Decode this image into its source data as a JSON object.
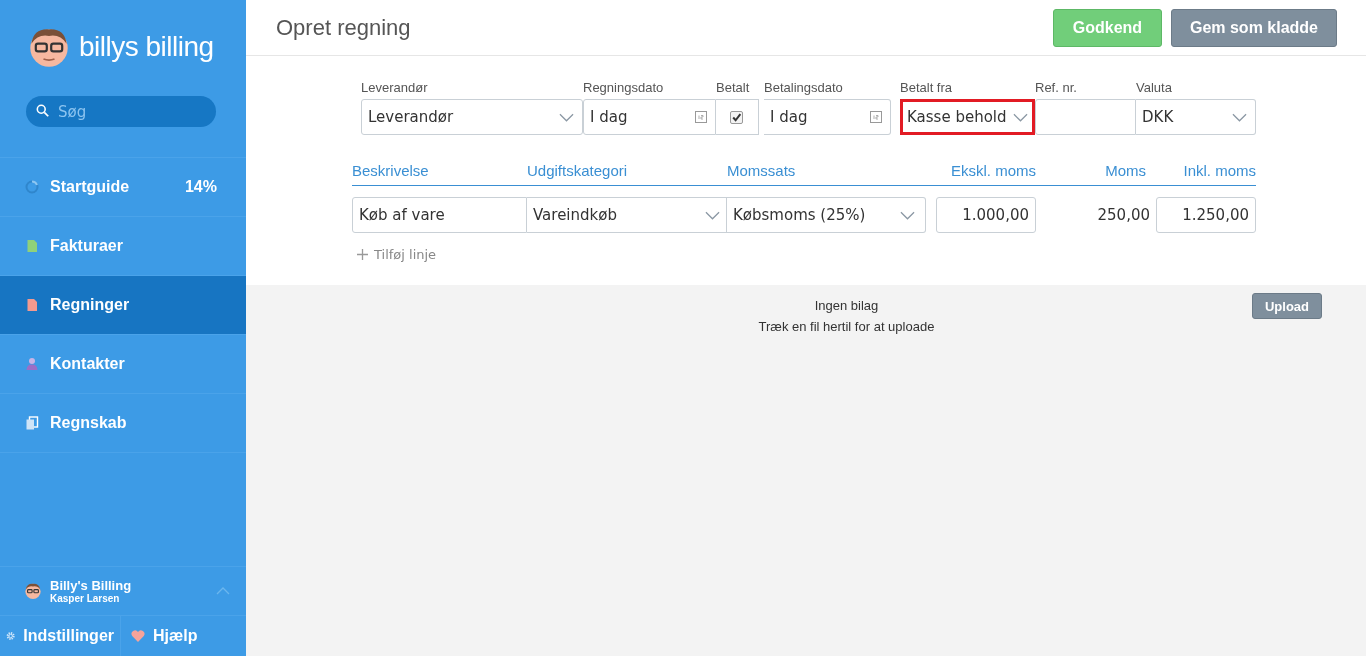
{
  "sidebar": {
    "brand": "billys billing",
    "search": {
      "placeholder": "Søg"
    },
    "items": [
      {
        "kind": "guide",
        "label": "Startguide",
        "badge": "14%",
        "selected": false
      },
      {
        "kind": "invoice",
        "label": "Fakturaer",
        "selected": false
      },
      {
        "kind": "bill",
        "label": "Regninger",
        "selected": true
      },
      {
        "kind": "contact",
        "label": "Kontakter",
        "selected": false
      },
      {
        "kind": "accounting",
        "label": "Regnskab",
        "selected": false
      }
    ],
    "account": {
      "company": "Billy's Billing",
      "user": "Kasper Larsen"
    },
    "footer": [
      {
        "kind": "settings",
        "label": "Indstillinger"
      },
      {
        "kind": "help",
        "label": "Hjælp"
      }
    ]
  },
  "header": {
    "title": "Opret regning",
    "buttons": [
      {
        "kind": "primary",
        "label": "Godkend"
      },
      {
        "kind": "secondary",
        "label": "Gem som kladde"
      }
    ]
  },
  "form": {
    "fields": [
      {
        "kind": "select",
        "label": "Leverandør",
        "value": "Leverandør",
        "highlighted": false
      },
      {
        "kind": "date",
        "label": "Regningsdato",
        "value": "I dag",
        "highlighted": false
      },
      {
        "kind": "checkbox",
        "label": "Betalt",
        "checked": true
      },
      {
        "kind": "date",
        "label": "Betalingsdato",
        "value": "I dag",
        "highlighted": false
      },
      {
        "kind": "select",
        "label": "Betalt fra",
        "value": "Kasse behold",
        "highlighted": true
      },
      {
        "kind": "text",
        "label": "Ref. nr.",
        "highlighted": false
      },
      {
        "kind": "select",
        "label": "Valuta",
        "value": "DKK",
        "highlighted": false
      }
    ]
  },
  "lines": {
    "columns": [
      "Beskrivelse",
      "Udgiftskategori",
      "Momssats",
      "Ekskl. moms",
      "Moms",
      "Inkl. moms"
    ],
    "rows": [
      {
        "description": "Køb af vare",
        "category": "Vareindkøb",
        "vat_rate": "Købsmoms (25%)",
        "excl": "1.000,00",
        "vat": "250,00",
        "incl": "1.250,00"
      }
    ],
    "add_line": "Tilføj linje"
  },
  "attachments": {
    "empty": "Ingen bilag",
    "hint": "Træk en fil hertil for at uploade",
    "upload": "Upload"
  }
}
